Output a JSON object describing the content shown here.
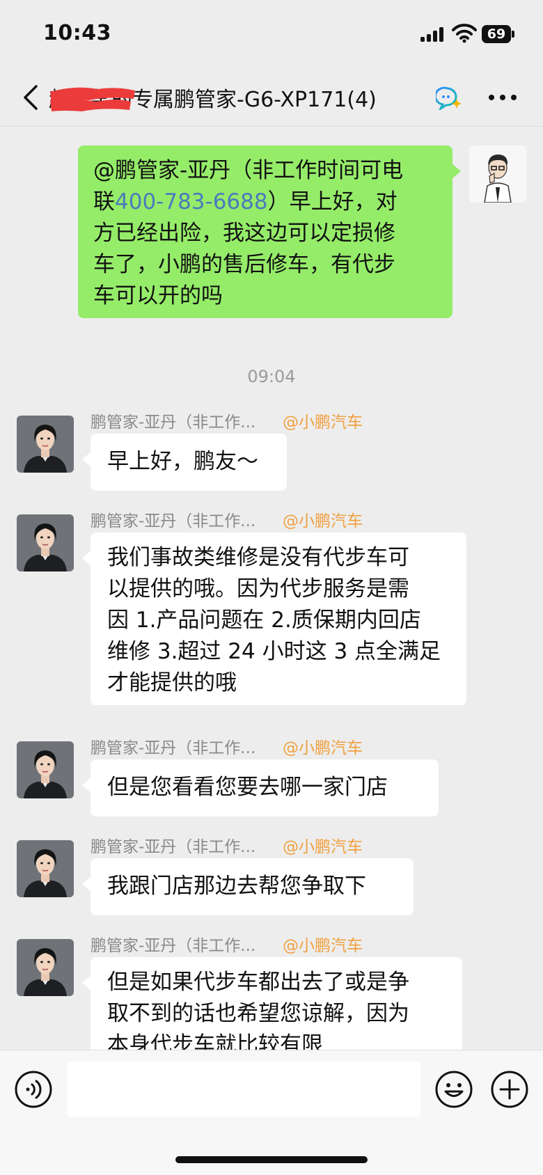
{
  "status_bar": {
    "time": "10:43",
    "battery": "69"
  },
  "nav": {
    "title": "赵子某的专属鹏管家-G6-XP171(4)"
  },
  "messages": {
    "outgoing": {
      "line1": "@鹏管家-亚丹（非工作时间可电",
      "line2_pre": "联",
      "phone": "400-783-6688",
      "line2_post": "）早上好，对",
      "line3": "方已经出险，我这边可以定损修",
      "line4": "车了，小鹏的售后修车，有代步",
      "line5": "车可以开的吗"
    },
    "timestamp": "09:04",
    "sender_name": "鹏管家-亚丹（非工作...",
    "sender_org": "@小鹏汽车",
    "in1": {
      "line1": "早上好，鹏友～"
    },
    "in2": {
      "line1": "我们事故类维修是没有代步车可",
      "line2": "以提供的哦。因为代步服务是需",
      "line3": "因 1.产品问题在 2.质保期内回店",
      "line4": "维修 3.超过 24 小时这 3 点全满足",
      "line5": "才能提供的哦"
    },
    "in3": {
      "line1": "但是您看看您要去哪一家门店"
    },
    "in4": {
      "line1": "我跟门店那边去帮您争取下"
    },
    "in5": {
      "line1": "但是如果代步车都出去了或是争",
      "line2": "取不到的话也希望您谅解，因为",
      "line3": "本身代步车就比较有限"
    }
  },
  "input": {
    "placeholder": ""
  },
  "colors": {
    "outgoing_bubble": "#95ec69",
    "incoming_bubble": "#ffffff",
    "org_tag": "#f0a040",
    "phone_link": "#4a7bbd"
  },
  "icons": [
    "back-icon",
    "bot-icon",
    "more-icon",
    "voice-icon",
    "emoji-icon",
    "plus-icon"
  ]
}
